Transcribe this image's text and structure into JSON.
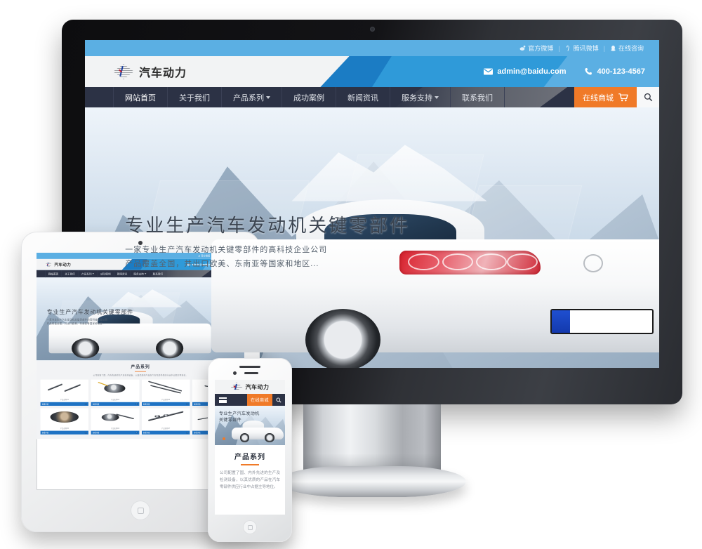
{
  "brand": {
    "name": "汽车动力",
    "logo_icon": "diamond-check-logo-icon",
    "accent_blue": "#1f73c4",
    "accent_orange": "#f07a28",
    "nav_dark": "#2c3245",
    "header_light_blue": "#5bafe3"
  },
  "topbar": {
    "links": [
      {
        "label": "官方微博",
        "icon": "weibo-icon"
      },
      {
        "label": "腾讯微博",
        "icon": "tencent-weibo-icon"
      },
      {
        "label": "在线咨询",
        "icon": "qq-penguin-icon"
      }
    ],
    "separator": "|"
  },
  "header": {
    "email": "admin@baidu.com",
    "email_icon": "envelope-icon",
    "phone": "400-123-4567",
    "phone_icon": "phone-icon"
  },
  "nav": {
    "items": [
      {
        "label": "网站首页",
        "dropdown": false
      },
      {
        "label": "关于我们",
        "dropdown": false
      },
      {
        "label": "产品系列",
        "dropdown": true
      },
      {
        "label": "成功案例",
        "dropdown": false
      },
      {
        "label": "新闻资讯",
        "dropdown": false
      },
      {
        "label": "服务支持",
        "dropdown": true
      },
      {
        "label": "联系我们",
        "dropdown": false
      }
    ],
    "shop_label": "在线商城",
    "cart_icon": "shopping-cart-icon",
    "search_icon": "search-icon"
  },
  "hero": {
    "headline": "专业生产汽车发动机关键零部件",
    "line1": "一家专业生产汽车发动机关键零部件的高科技企业公司",
    "line2": "产品覆盖全国，并出口欧美、东南亚等国家和地区..."
  },
  "products": {
    "title": "产品系列",
    "subtitle": "公司配置了国、内外先进的生产及检测设备，以其优质的产品在汽车零部件供应行业中占据主导地位。",
    "detail_label": "查看详情",
    "detail_arrow": "›",
    "items": [
      {
        "name": "产品名称01",
        "shape": "camshaft"
      },
      {
        "name": "产品名称02",
        "shape": "clockspring"
      },
      {
        "name": "产品名称03",
        "shape": "linkage"
      },
      {
        "name": "产品名称04",
        "shape": "bracket"
      },
      {
        "name": "产品名称05",
        "shape": "pulley"
      },
      {
        "name": "产品名称06",
        "shape": "strut"
      },
      {
        "name": "产品名称07",
        "shape": "injector"
      },
      {
        "name": "产品名称08",
        "shape": "rod"
      }
    ]
  },
  "phone": {
    "hero_line1": "专业生产汽车发动机",
    "hero_line2": "关键零部件",
    "section_title": "产品系列",
    "body": "公司配置了国、内外先进的生产及检测设备，以其优质的产品在汽车零部件供应行业中占据主导地位。",
    "menu_icon": "hamburger-menu-icon",
    "shop_label": "在线商城",
    "search_icon": "search-icon"
  },
  "devices": {
    "monitor": "desktop-monitor",
    "tablet": "tablet-device",
    "phone": "smartphone-device"
  }
}
